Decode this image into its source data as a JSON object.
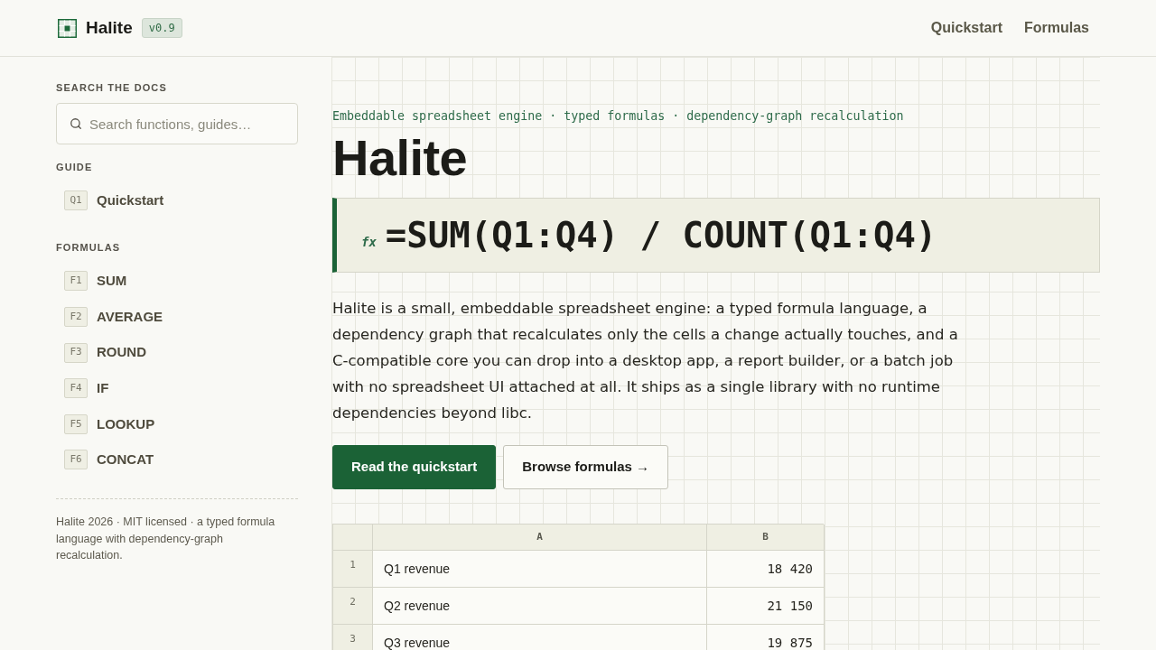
{
  "header": {
    "logo": "Halite",
    "version": "v0.9",
    "nav": [
      {
        "label": "Quickstart"
      },
      {
        "label": "Formulas"
      }
    ]
  },
  "sidebar": {
    "search": {
      "heading": "SEARCH THE DOCS",
      "placeholder": "Search functions, guides…"
    },
    "sections": [
      {
        "title": "GUIDE",
        "items": [
          {
            "key": "Q1",
            "label": "Quickstart"
          }
        ]
      },
      {
        "title": "FORMULAS",
        "items": [
          {
            "key": "F1",
            "label": "SUM"
          },
          {
            "key": "F2",
            "label": "AVERAGE"
          },
          {
            "key": "F3",
            "label": "ROUND"
          },
          {
            "key": "F4",
            "label": "IF"
          },
          {
            "key": "F5",
            "label": "LOOKUP"
          },
          {
            "key": "F6",
            "label": "CONCAT"
          }
        ]
      }
    ],
    "footer": "Halite 2026 · MIT licensed · a typed formula language with dependency-graph recalculation."
  },
  "main": {
    "tagline": "Embeddable spreadsheet engine · typed formulas · dependency-graph recalculation",
    "title": "Halite",
    "formula": {
      "prefix": "fx",
      "text": "=SUM(Q1:Q4) / COUNT(Q1:Q4)"
    },
    "description": "Halite is a small, embeddable spreadsheet engine: a typed formula language, a dependency graph that recalculates only the cells a change actually touches, and a C-compatible core you can drop into a desktop app, a report builder, or a batch job with no spreadsheet UI attached at all. It ships as a single library with no runtime dependencies beyond libc.",
    "buttons": [
      {
        "label": "Read the quickstart",
        "kind": "primary"
      },
      {
        "label": "Browse formulas →",
        "kind": "secondary"
      }
    ],
    "sheet": {
      "columns": [
        "A",
        "B"
      ],
      "rows": [
        {
          "number": "1",
          "cells": [
            "Q1 revenue",
            "18 420"
          ]
        },
        {
          "number": "2",
          "cells": [
            "Q2 revenue",
            "21 150"
          ]
        },
        {
          "number": "3",
          "cells": [
            "Q3 revenue",
            "19 875"
          ]
        }
      ]
    }
  }
}
